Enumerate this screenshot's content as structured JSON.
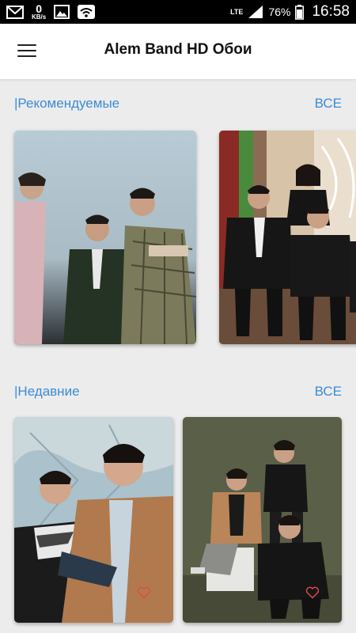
{
  "status_bar": {
    "speed_value": "0",
    "speed_unit": "KB/s",
    "network": "LTE",
    "battery": "76%",
    "time": "16:58",
    "icons": [
      "gmail-icon",
      "image-icon",
      "wifi-icon",
      "signal-icon",
      "battery-icon"
    ]
  },
  "header": {
    "title": "Alem Band HD Обои",
    "menu_icon": "hamburger-menu-icon"
  },
  "sections": {
    "featured": {
      "title": "|Рекомендуемые",
      "see_all": "ВСЕ"
    },
    "recent": {
      "title": "|Недавние",
      "see_all": "ВСЕ"
    }
  },
  "colors": {
    "accent": "#3b8bd4",
    "background": "#ececec",
    "heart": "#e54848"
  }
}
